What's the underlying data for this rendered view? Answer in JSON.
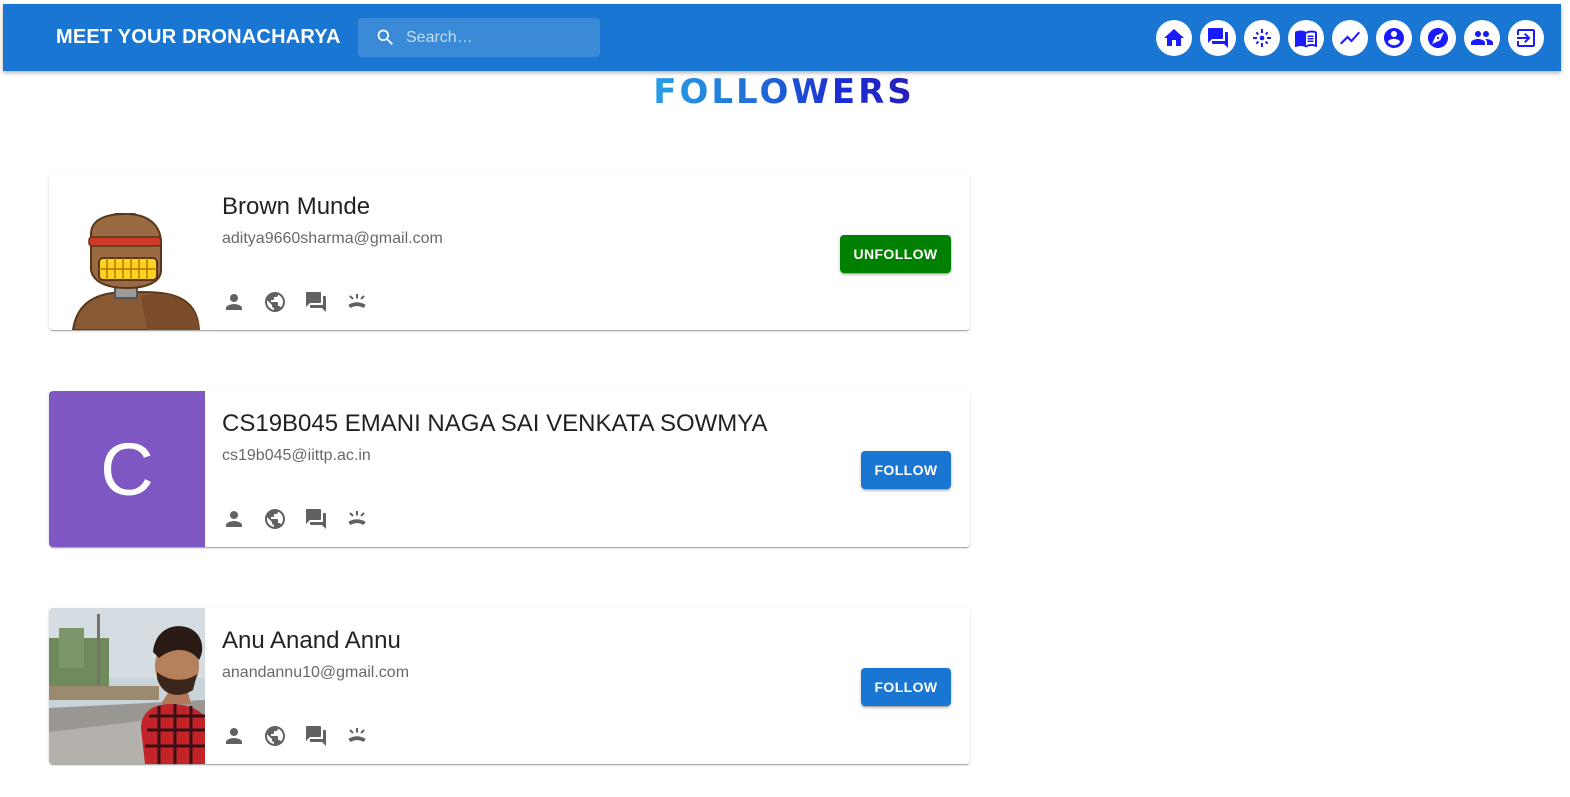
{
  "colors": {
    "appbar": "#1976d2",
    "nav_icon": "#1a1aff",
    "unfollow_button": "#008000",
    "follow_button": "#1976d2",
    "letter_avatar": "#7e57c2"
  },
  "appbar": {
    "brand": "MEET YOUR DRONACHARYA",
    "search": {
      "placeholder": "Search…",
      "value": "",
      "icon": "search-icon"
    },
    "nav_icons": [
      "home-icon",
      "forum-icon",
      "mentor-icon",
      "book-icon",
      "trending-icon",
      "account-icon",
      "explore-icon",
      "people-icon",
      "logout-icon"
    ]
  },
  "page": {
    "title": "FOLLOWERS"
  },
  "followers": [
    {
      "name": "Brown Munde",
      "email": "aditya9660sharma@gmail.com",
      "avatar": "robot-avatar",
      "button_label": "UNFOLLOW",
      "button_color": "#008000",
      "actions": [
        "person-icon",
        "globe-icon",
        "forum-icon",
        "call-end-icon"
      ]
    },
    {
      "name": "CS19B045 EMANI NAGA SAI VENKATA SOWMYA",
      "email": "cs19b045@iittp.ac.in",
      "avatar_letter": "C",
      "button_label": "FOLLOW",
      "button_color": "#1976d2",
      "actions": [
        "person-icon",
        "globe-icon",
        "forum-icon",
        "call-end-icon"
      ]
    },
    {
      "name": "Anu Anand Annu",
      "email": "anandannu10@gmail.com",
      "avatar": "profile-photo",
      "button_label": "FOLLOW",
      "button_color": "#1976d2",
      "actions": [
        "person-icon",
        "globe-icon",
        "forum-icon",
        "call-end-icon"
      ]
    }
  ]
}
